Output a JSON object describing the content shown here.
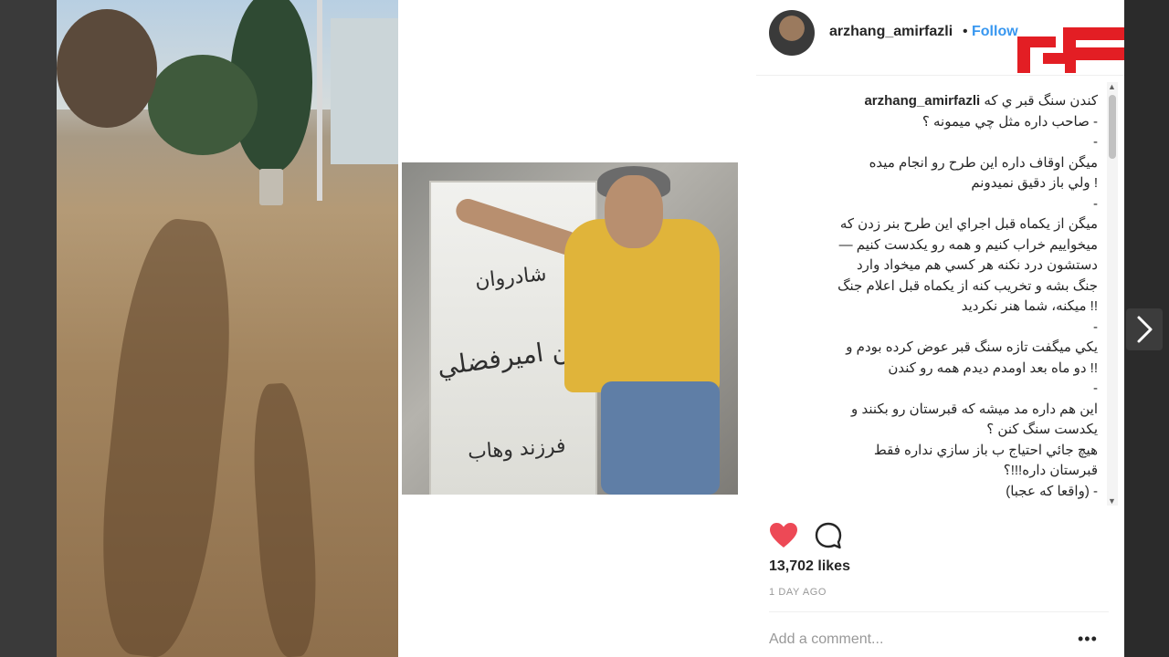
{
  "post": {
    "username": "arzhang_amirfazli",
    "separator": "•",
    "follow_label": "Follow",
    "caption_user": "arzhang_amirfazli",
    "caption_lines": [
      "کندن سنگ قبر ي که",
      "- صاحب داره مثل چي ميمونه ؟",
      "-",
      "ميگن اوقاف داره اين طرح رو انجام ميده",
      "! ولي باز دقيق نميدونم",
      "-",
      "ميگن از يکماه قبل اجراي اين طرح بنر زدن که",
      "ميخواييم خراب کنيم و همه رو يکدست کنيم —",
      "دستشون درد نکنه هر کسي هم ميخواد وارد",
      "جنگ بشه و تخريب کنه از يکماه قبل اعلام جنگ",
      "!! ميکنه، شما هنر نکرديد",
      "-",
      "يکي ميگفت تازه سنگ قبر عوض کرده بودم و",
      "!! دو ماه بعد اومدم ديدم همه رو کندن",
      "-",
      "اين هم داره مد ميشه که قبرستان رو بکنند و",
      "يکدست سنگ کنن ؟",
      "هيچ جائي احتياج ب باز سازي نداره فقط",
      "قبرستان داره!!!؟",
      "- (واقعا که عجبا)"
    ],
    "likes": "13,702 likes",
    "time_ago": "1 DAY AGO",
    "comment_placeholder": "Add a comment...",
    "more_label": "•••"
  },
  "gravestone": {
    "line1": "شادروان",
    "line2": "حسين اميرفضلي",
    "line3": "فرزند وهاب"
  },
  "icons": {
    "heart": "heart-icon",
    "comment": "comment-icon",
    "next": "chevron-right-icon"
  },
  "colors": {
    "accent": "#3897f0",
    "heart": "#ed4956",
    "logo": "#e31e24"
  }
}
